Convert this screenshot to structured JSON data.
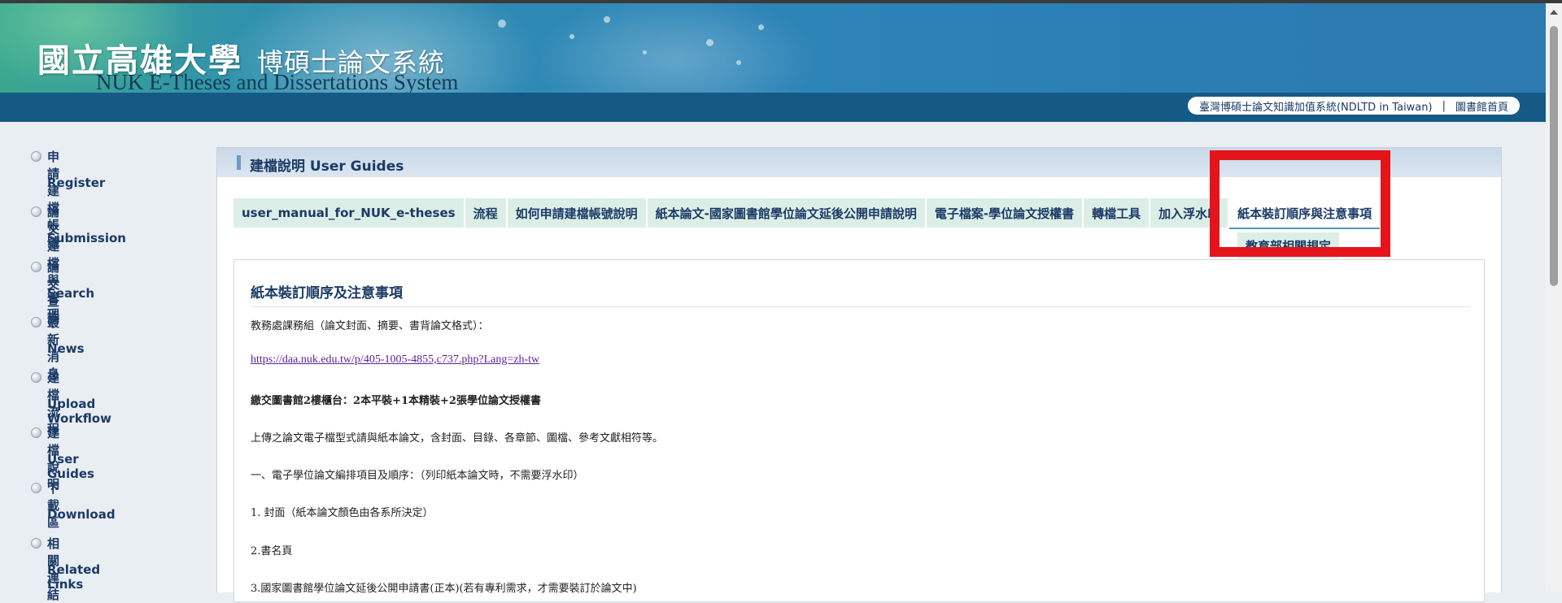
{
  "header": {
    "title_zh": "國立高雄大學",
    "title_zh_sub": "博碩士論文系統",
    "title_en": "NUK E-Theses and Dissertations System"
  },
  "top_links": {
    "ndltd": "臺灣博碩士論文知識加值系統(NDLTD in Taiwan)",
    "separator": "|",
    "library": "圖書館首頁"
  },
  "sidebar": {
    "items": [
      {
        "zh": "申請建檔帳號",
        "en": "Register"
      },
      {
        "zh": "論文建檔與管理",
        "en": "Submission"
      },
      {
        "zh": "論文查詢",
        "en": "Search"
      },
      {
        "zh": "最新消息",
        "en": "News"
      },
      {
        "zh": "建檔流程",
        "en": "Upload Workflow"
      },
      {
        "zh": "建檔說明",
        "en": "User Guides"
      },
      {
        "zh": "下載區",
        "en": "Download"
      },
      {
        "zh": "相關連結",
        "en": "Related Links"
      }
    ]
  },
  "main": {
    "title": "建檔說明 User Guides",
    "tabs": [
      {
        "label": "user_manual_for_NUK_e-theses"
      },
      {
        "label": "流程"
      },
      {
        "label": "如何申請建檔帳號說明"
      },
      {
        "label": "紙本論文-國家圖書館學位論文延後公開申請說明"
      },
      {
        "label": "電子檔案-學位論文授權書"
      },
      {
        "label": "轉檔工具"
      },
      {
        "label": "加入浮水印"
      },
      {
        "label": "紙本裝訂順序與注意事項"
      }
    ],
    "tabs_row2": [
      {
        "label": "教育部相關規定"
      }
    ],
    "active_tab": "紙本裝訂順序與注意事項"
  },
  "content": {
    "heading": "紙本裝訂順序及注意事項",
    "lines": {
      "l1": "教務處課務組（論文封面、摘要、書背論文格式）：",
      "l2": "https://daa.nuk.edu.tw/p/405-1005-4855,c737.php?Lang=zh-tw",
      "l3": "繳交圖書館2樓櫃台：2本平裝+1本精裝+2張學位論文授權書",
      "l4": "上傳之論文電子檔型式請與紙本論文，含封面、目錄、各章節、圖檔、參考文獻相符等。",
      "l5": "一、電子學位論文編排項目及順序：（列印紙本論文時，不需要浮水印）",
      "l6": "1. 封面（紙本論文顏色由各系所決定）",
      "l7": "2.書名頁",
      "l8": "3.國家圖書館學位論文延後公開申請書(正本)(若有專利需求，才需要裝訂於論文中)"
    }
  },
  "colors": {
    "brand": "#155a85",
    "accent": "#1b3a66",
    "tab_bg": "#dcefe7",
    "highlight": "#e5141b"
  }
}
